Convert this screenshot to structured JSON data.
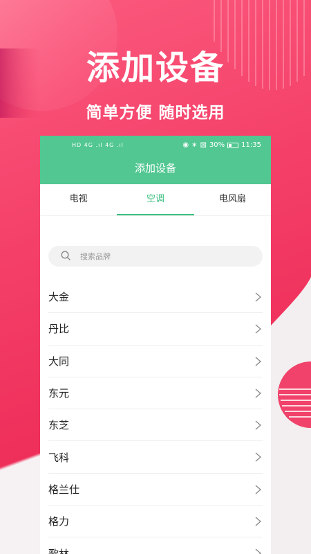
{
  "promo": {
    "headline": "添加设备",
    "subline": "简单方便 随时选用"
  },
  "status_bar": {
    "signal": "HD 4G .ıl 4G .ıl",
    "battery": "30%",
    "time": "11:35"
  },
  "header": {
    "title": "添加设备"
  },
  "tabs": [
    {
      "label": "电视"
    },
    {
      "label": "空调"
    },
    {
      "label": "电风扇"
    }
  ],
  "active_tab": "空调",
  "search": {
    "placeholder": "搜索品牌"
  },
  "brands": [
    {
      "name": "大金"
    },
    {
      "name": "丹比"
    },
    {
      "name": "大同"
    },
    {
      "name": "东元"
    },
    {
      "name": "东芝"
    },
    {
      "name": "飞科"
    },
    {
      "name": "格兰仕"
    },
    {
      "name": "格力"
    },
    {
      "name": "歌林"
    }
  ],
  "colors": {
    "header_green": "#52c792",
    "tab_active": "#3cbf80",
    "promo_pink": "#f43f68"
  }
}
